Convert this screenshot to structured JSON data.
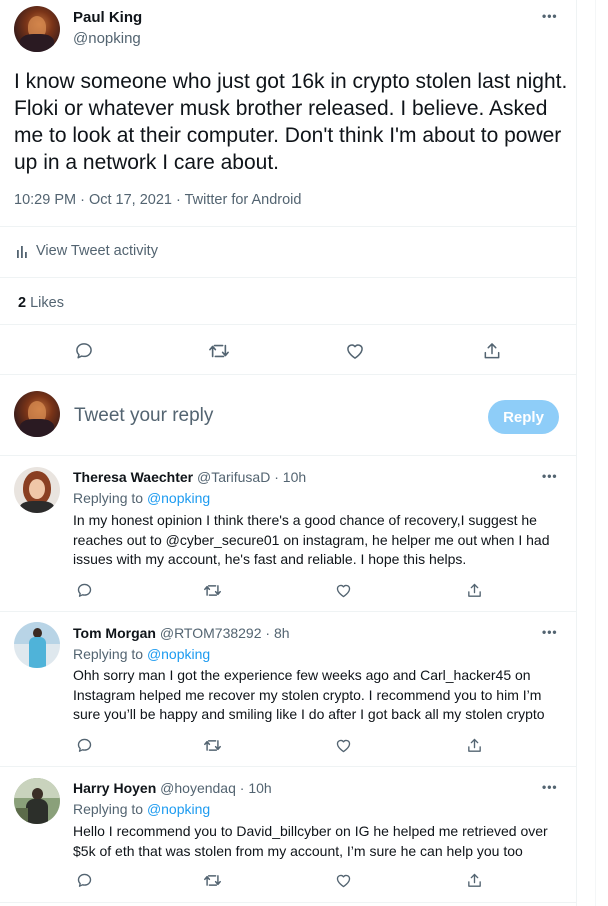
{
  "main_tweet": {
    "author_name": "Paul King",
    "author_handle": "@nopking",
    "more_label": "•••",
    "text": "I know someone who just got 16k in crypto stolen last night. Floki or whatever musk brother released. I believe. Asked me to look at their computer. Don't think I'm about to power up in a network I care about.",
    "timestamp": "10:29 PM · Oct 17, 2021 · Twitter for Android",
    "activity_label": "View Tweet activity",
    "likes_count": "2",
    "likes_label": "Likes"
  },
  "composer": {
    "placeholder": "Tweet your reply",
    "reply_button": "Reply"
  },
  "replies": [
    {
      "name": "Theresa Waechter",
      "handle": "@TarifusaD",
      "time": "10h",
      "replying_prefix": "Replying to",
      "replying_to": "@nopking",
      "text": "In my honest opinion I think there's a good chance of recovery,I suggest he reaches out to @cyber_secure01 on instagram, he helper me out when I had issues with my account, he's fast and reliable. I hope this helps."
    },
    {
      "name": "Tom Morgan",
      "handle": "@RTOM738292",
      "time": "8h",
      "replying_prefix": "Replying to",
      "replying_to": "@nopking",
      "text": "Ohh sorry man I got the experience few weeks ago and Carl_hacker45 on Instagram helped me recover my stolen crypto. I recommend you to him I’m sure you’ll be happy and smiling like I do after I got back all my stolen crypto"
    },
    {
      "name": "Harry Hoyen",
      "handle": "@hoyendaq",
      "time": "10h",
      "replying_prefix": "Replying to",
      "replying_to": "@nopking",
      "text": "Hello I  recommend you to David_billcyber on IG he helped me retrieved over $5k of eth that was stolen from my account, I’m sure he can help you too"
    }
  ],
  "colors": {
    "accent": "#1d9bf0",
    "reply_button_disabled": "#8ecdf8",
    "secondary_text": "#536471",
    "border": "#eff3f4"
  },
  "icons": [
    "reply-icon",
    "retweet-icon",
    "like-icon",
    "share-icon",
    "more-icon",
    "activity-icon"
  ]
}
